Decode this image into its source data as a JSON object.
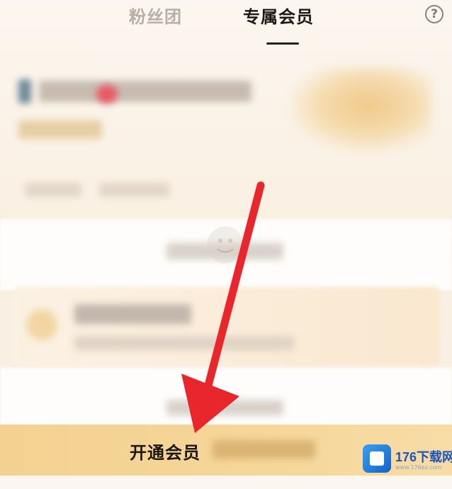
{
  "tabs": [
    {
      "label": "粉丝团",
      "active": false
    },
    {
      "label": "专属会员",
      "active": true
    }
  ],
  "help": {
    "label": "?"
  },
  "open_member": {
    "label": "开通会员"
  },
  "watermark": {
    "brand": "176下载网",
    "url": "www.176ez.com"
  },
  "colors": {
    "accent_bar": "#f3d191",
    "arrow": "#e8262c",
    "active_tab": "#1e1a17",
    "inactive_tab": "#b7aea6"
  }
}
